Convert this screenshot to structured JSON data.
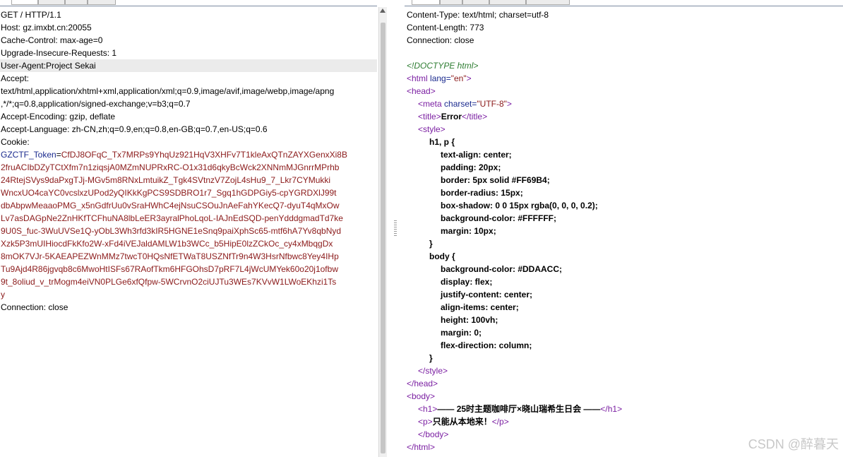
{
  "request": {
    "lines": [
      "GET / HTTP/1.1",
      "Host: gz.imxbt.cn:20055",
      "Cache-Control: max-age=0",
      "Upgrade-Insecure-Requests: 1",
      "User-Agent:Project Sekai",
      "Accept:",
      "text/html,application/xhtml+xml,application/xml;q=0.9,image/avif,image/webp,image/apng",
      ",*/*;q=0.8,application/signed-exchange;v=b3;q=0.7",
      "Accept-Encoding: gzip, deflate",
      "Accept-Language: zh-CN,zh;q=0.9,en;q=0.8,en-GB;q=0.7,en-US;q=0.6",
      "Cookie:"
    ],
    "cookie_key": "GZCTF_Token",
    "cookie_eq": "=",
    "cookie_lines": [
      "CfDJ8OFqC_Tx7MRPs9YhqUz921HqV3XHFv7T1kleAxQTnZAYXGenxXi8B",
      "2fruACIbDZyTCtXfm7n1ziqsjA0MZmNUPRxRC-O1x31d6qkyBcWck2XNNmMJGnrrMPrhb",
      "24RtejSVys9daPxgTJj-MGv5m8RNxLmtuikZ_Tgk4SVtnzV7ZojL4sHu9_7_Lkr7CYMukki",
      "WncxUO4caYC0vcslxzUPod2yQIKkKgPCS9SDBRO1r7_Sgq1hGDPGiy5-cpYGRDXlJ99t",
      "dbAbpwMeaaoPMG_x5nGdfrUu0vSraHWhC4ejNsuCSOuJnAeFahYKecQ7-dyuT4qMxOw",
      "Lv7asDAGpNe2ZnHKfTCFhuNA8lbLeER3ayralPhoLqoL-IAJnEdSQD-penYdddgmadTd7ke",
      "9U0S_fuc-3WuUVSe1Q-yObL3Wh3rfd3kIR5HGNE1eSnq9paiXphSc65-mtf6hA7Yv8qbNyd",
      "Xzk5P3mUIHiocdFkKfo2W-xFd4iVEJaldAMLW1b3WCc_b5HipE0lzZCkOc_cy4xMbqgDx",
      "8mOK7VJr-5KAEAPEZWnMMz7twcT0HQsNfETWaT8USZNfTr9n4W3HsrNfbwc8Yey4IHp",
      "Tu9Ajd4R86jgvqb8c6MwoHtISFs67RAofTkm6HFGOhsD7pRF7L4jWcUMYek60o20j1ofbw",
      "9t_8oliud_v_trMogm4eiVN0PLGe6xfQfpw-5WCrvnO2ciUJTu3WEs7KVvW1LWoEKhzi1Ts",
      "y"
    ],
    "after_lines": [
      "Connection: close"
    ]
  },
  "response": {
    "headers": [
      "Content-Type: text/html; charset=utf-8",
      "Content-Length: 773",
      "Connection: close"
    ],
    "doctype": "<!DOCTYPE html>",
    "html_open": "<html",
    "html_lang_attr": "lang=",
    "html_lang_val": "\"en\"",
    "close_bracket": ">",
    "head_open": "<head>",
    "meta_open": "<meta",
    "meta_attr": "charset=",
    "meta_val": "\"UTF-8\"",
    "title_open": "<title>",
    "title_text": "Error",
    "title_close": "</title>",
    "style_open": "<style>",
    "css_lines": [
      "h1, p {",
      "text-align: center;",
      "padding: 20px;",
      "border: 5px solid #FF69B4;",
      "border-radius: 15px;",
      "box-shadow: 0 0 15px rgba(0, 0, 0, 0.2);",
      "background-color: #FFFFFF;",
      "margin: 10px;",
      "}",
      "body {",
      "background-color: #DDAACC;",
      "display: flex;",
      "justify-content: center;",
      "align-items: center;",
      "height: 100vh;",
      "margin: 0;",
      "flex-direction: column;",
      "}"
    ],
    "style_close": "</style>",
    "head_close": "</head>",
    "body_open": "<body>",
    "h1_open": "<h1>",
    "h1_text": "—— 25时主题咖啡厅×晓山瑞希生日会 ——",
    "h1_close": "</h1>",
    "p_open": "<p>",
    "p_text": "只能从本地来！",
    "p_close": "</p>",
    "body_close": "</body>",
    "html_close": "</html>"
  },
  "watermark": "CSDN @醉暮天"
}
